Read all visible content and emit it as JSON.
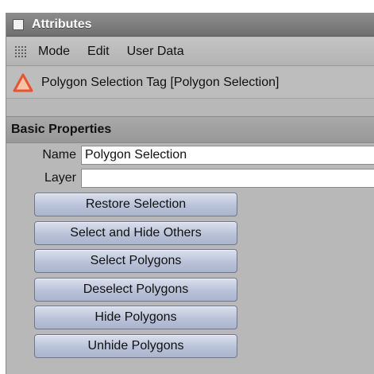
{
  "window": {
    "title": "Attributes"
  },
  "menu": {
    "items": [
      "Mode",
      "Edit",
      "User Data"
    ]
  },
  "object": {
    "label": "Polygon Selection Tag [Polygon Selection]"
  },
  "section": {
    "title": "Basic Properties"
  },
  "fields": {
    "name": {
      "label": "Name",
      "value": "Polygon Selection"
    },
    "layer": {
      "label": "Layer",
      "value": ""
    }
  },
  "buttons": [
    "Restore Selection",
    "Select and Hide Others",
    "Select Polygons",
    "Deselect Polygons",
    "Hide Polygons",
    "Unhide Polygons"
  ],
  "colors": {
    "tag_icon": "#e8542f",
    "button_face": "#b9c2d8"
  }
}
